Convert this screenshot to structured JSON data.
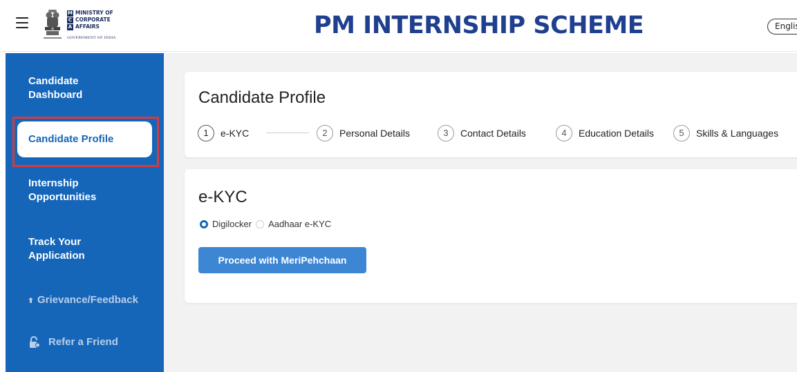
{
  "header": {
    "logo": {
      "ministry_line1": "MINISTRY OF",
      "ministry_line2": "CORPORATE",
      "ministry_line3": "AFFAIRS",
      "government": "GOVERNMENT OF INDIA"
    },
    "title": "PM INTERNSHIP SCHEME",
    "language_label": "Englis"
  },
  "sidebar": {
    "items": [
      {
        "label_line1": "Candidate",
        "label_line2": "Dashboard"
      },
      {
        "label": "Candidate Profile",
        "active": true
      },
      {
        "label_line1": "Internship",
        "label_line2": "Opportunities"
      },
      {
        "label_line1": "Track Your",
        "label_line2": "Application"
      },
      {
        "label": "Grievance/Feedback"
      },
      {
        "label": "Refer a Friend"
      }
    ]
  },
  "profile": {
    "title": "Candidate Profile",
    "steps": [
      {
        "number": "1",
        "label": "e-KYC"
      },
      {
        "number": "2",
        "label": "Personal Details"
      },
      {
        "number": "3",
        "label": "Contact Details"
      },
      {
        "number": "4",
        "label": "Education Details"
      },
      {
        "number": "5",
        "label": "Skills & Languages"
      }
    ]
  },
  "ekyc": {
    "title": "e-KYC",
    "options": [
      {
        "label": "Digilocker",
        "selected": true
      },
      {
        "label": "Aadhaar e-KYC",
        "selected": false
      }
    ],
    "button_label": "Proceed with MeriPehchaan"
  },
  "colors": {
    "sidebar_bg": "#1565b9",
    "title_blue": "#1f3f8f",
    "button_bg": "#3c86d4",
    "highlight_red": "#d83a3a"
  }
}
